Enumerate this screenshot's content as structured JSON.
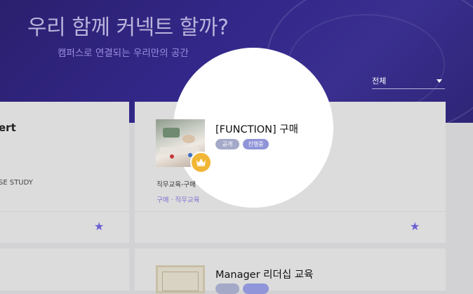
{
  "hero": {
    "title": "우리 함께 커넥트 할까?",
    "subtitle": "캠퍼스로 연결되는 우리만의 공간"
  },
  "filter": {
    "selected": "전체"
  },
  "cards": [
    {
      "title_partial": "ert",
      "subtitle_partial": "SE STUDY",
      "favorite_icon": "star-icon"
    },
    {
      "title": "[FUNCTION] 구매",
      "badges": [
        "공개",
        "진행중"
      ],
      "category": "직무교육-구매",
      "tags": "구매 · 직무교육",
      "favorite_icon": "star-icon",
      "owner_icon": "crown-icon"
    },
    {
      "title": "Manager 리더십 교육"
    }
  ],
  "colors": {
    "hero_bg": "#33288a",
    "accent": "#6a5fd2",
    "badge_public": "#a4a9c8",
    "badge_progress": "#8f95d8",
    "crown": "#f2b636"
  }
}
